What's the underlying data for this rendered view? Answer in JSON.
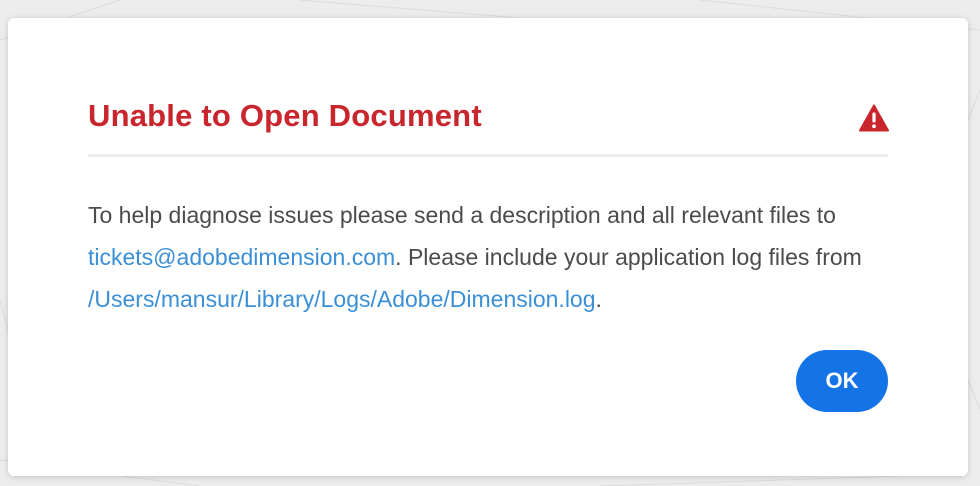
{
  "dialog": {
    "title": "Unable to Open Document",
    "icon": "warning-icon",
    "message": {
      "part1": "To help diagnose issues please send a description and all relevant files to ",
      "email": "tickets@adobedimension.com",
      "part2": ". Please include your application log files from ",
      "log_path": "/Users/mansur/Library/Logs/Adobe/Dimension.log",
      "part3": "."
    },
    "ok_label": "OK"
  },
  "colors": {
    "title": "#c9252d",
    "link": "#3a8fd6",
    "button": "#1473e6",
    "text": "#4b4b4b"
  }
}
